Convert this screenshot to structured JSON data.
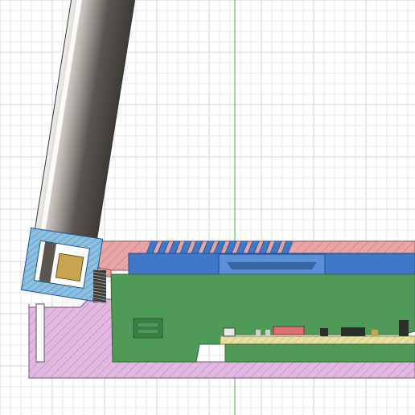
{
  "app": {
    "view": "cad-section-view"
  },
  "colors": {
    "background": "#ffffff",
    "grid_minor": "#e6eaee",
    "grid_major": "#cfd5db",
    "origin_axis": "#4caf50",
    "section_pink": "#e7a6a8",
    "section_pink_hatch": "#c97c80",
    "section_purple": "#e2b8e2",
    "section_purple_hatch": "#b987bb",
    "section_blue": "#3f78c9",
    "section_blue_light": "#5b8fd9",
    "pcb_green": "#4f9a57",
    "pcb_green_dark": "#3c7d43",
    "board_yellow": "#e8e0a0",
    "screen_dark": "#5a5550",
    "screen_light": "#f3f1ed",
    "frame_blue": "#8cc0e0",
    "frame_hatch": "#4f89b5",
    "component_tan": "#c9a450",
    "component_dark": "#2d2d2d",
    "component_red": "#e07070"
  },
  "icons": {
    "origin": "origin-axis-icon"
  }
}
